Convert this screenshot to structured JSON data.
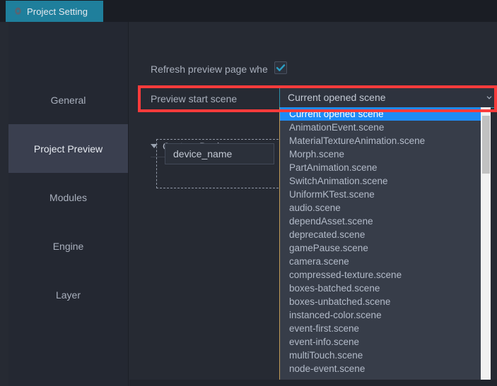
{
  "window": {
    "tab": {
      "label": "Project Setting",
      "icon": "gear-icon",
      "active_color": "#1f7f9c"
    }
  },
  "sidebar": {
    "items": [
      {
        "label": "General",
        "selected": false
      },
      {
        "label": "Project Preview",
        "selected": true
      },
      {
        "label": "Modules",
        "selected": false
      },
      {
        "label": "Engine",
        "selected": false
      },
      {
        "label": "Layer",
        "selected": false
      }
    ]
  },
  "content": {
    "refresh_row": {
      "label": "Refresh preview page whe",
      "checkbox_checked": "true",
      "checkbox_color": "#2b9fc4"
    },
    "preview_start_scene": {
      "label": "Preview start scene",
      "selected_value": "Current opened scene",
      "caret_icon": "chevron-down-icon",
      "focus_border_color": "#2b8fa6"
    },
    "custom_devices": {
      "title": "Custom Devices",
      "expander_icon": "triangle-down-icon",
      "expanded": "true",
      "device_name_value": "device_name"
    }
  },
  "dropdown": {
    "open": "true",
    "highlighted_index": 0,
    "border_color": "#c09a57",
    "highlight_color": "#1e8bf5",
    "options": [
      "Current opened scene",
      "AnimationEvent.scene",
      "MaterialTextureAnimation.scene",
      "Morph.scene",
      "PartAnimation.scene",
      "SwitchAnimation.scene",
      "UniformKTest.scene",
      "audio.scene",
      "dependAsset.scene",
      "deprecated.scene",
      "gamePause.scene",
      "camera.scene",
      "compressed-texture.scene",
      "boxes-batched.scene",
      "boxes-unbatched.scene",
      "instanced-color.scene",
      "event-first.scene",
      "event-info.scene",
      "multiTouch.scene",
      "node-event.scene"
    ],
    "scrollbar": {
      "track_color": "#f1f1f1",
      "thumb_color": "#c1c1c1"
    }
  },
  "annotations": [
    {
      "name": "preview-start-scene-highlight",
      "color": "#fb3b3b"
    }
  ],
  "editor_sliver": {
    "fragments": [
      "s",
      "-",
      "s",
      "e",
      "e",
      "s",
      "{",
      "e",
      "]",
      "v",
      "t",
      "s"
    ]
  }
}
